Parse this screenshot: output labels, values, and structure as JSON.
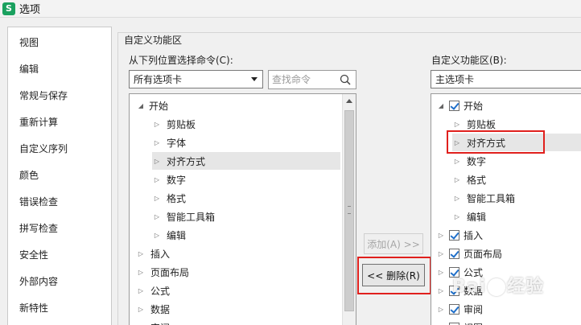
{
  "window": {
    "title": "选项",
    "icon_letter": "S"
  },
  "nav": {
    "items": [
      {
        "label": "视图"
      },
      {
        "label": "编辑"
      },
      {
        "label": "常规与保存"
      },
      {
        "label": "重新计算"
      },
      {
        "label": "自定义序列"
      },
      {
        "label": "颜色"
      },
      {
        "label": "错误检查"
      },
      {
        "label": "拼写检查"
      },
      {
        "label": "安全性"
      },
      {
        "label": "外部内容"
      },
      {
        "label": "新特性"
      }
    ]
  },
  "group": {
    "title": "自定义功能区"
  },
  "left": {
    "label": "从下列位置选择命令(C):",
    "combo_value": "所有选项卡",
    "search_placeholder": "查找命令",
    "tree": [
      {
        "label": "开始",
        "expander": "◢"
      },
      {
        "label": "剪贴板",
        "expander": "▷"
      },
      {
        "label": "字体",
        "expander": "▷"
      },
      {
        "label": "对齐方式",
        "expander": "▷"
      },
      {
        "label": "数字",
        "expander": "▷"
      },
      {
        "label": "格式",
        "expander": "▷"
      },
      {
        "label": "智能工具箱",
        "expander": "▷"
      },
      {
        "label": "编辑",
        "expander": "▷"
      },
      {
        "label": "插入",
        "expander": "▷"
      },
      {
        "label": "页面布局",
        "expander": "▷"
      },
      {
        "label": "公式",
        "expander": "▷"
      },
      {
        "label": "数据",
        "expander": "▷"
      },
      {
        "label": "审阅",
        "expander": "▷"
      }
    ]
  },
  "buttons": {
    "add_label": "添加(A) >>",
    "remove_label": "<< 删除(R)"
  },
  "right": {
    "label": "自定义功能区(B):",
    "combo_value": "主选项卡",
    "tree": [
      {
        "label": "开始",
        "expander": "◢",
        "checked": true
      },
      {
        "label": "剪贴板",
        "expander": "▷"
      },
      {
        "label": "对齐方式",
        "expander": "▷"
      },
      {
        "label": "数字",
        "expander": "▷"
      },
      {
        "label": "格式",
        "expander": "▷"
      },
      {
        "label": "智能工具箱",
        "expander": "▷"
      },
      {
        "label": "编辑",
        "expander": "▷"
      },
      {
        "label": "插入",
        "expander": "▷",
        "checked": true
      },
      {
        "label": "页面布局",
        "expander": "▷",
        "checked": true
      },
      {
        "label": "公式",
        "expander": "▷",
        "checked": true
      },
      {
        "label": "数据",
        "expander": "▷",
        "checked": true
      },
      {
        "label": "审阅",
        "expander": "▷",
        "checked": true
      },
      {
        "label": "视图",
        "expander": "▷",
        "checked": true
      }
    ]
  },
  "watermark": {
    "text_a": "Bai",
    "text_b": "经验"
  },
  "colors": {
    "highlight": "#e0201d",
    "check": "#1f6fc9",
    "app_icon": "#1aa15f"
  }
}
